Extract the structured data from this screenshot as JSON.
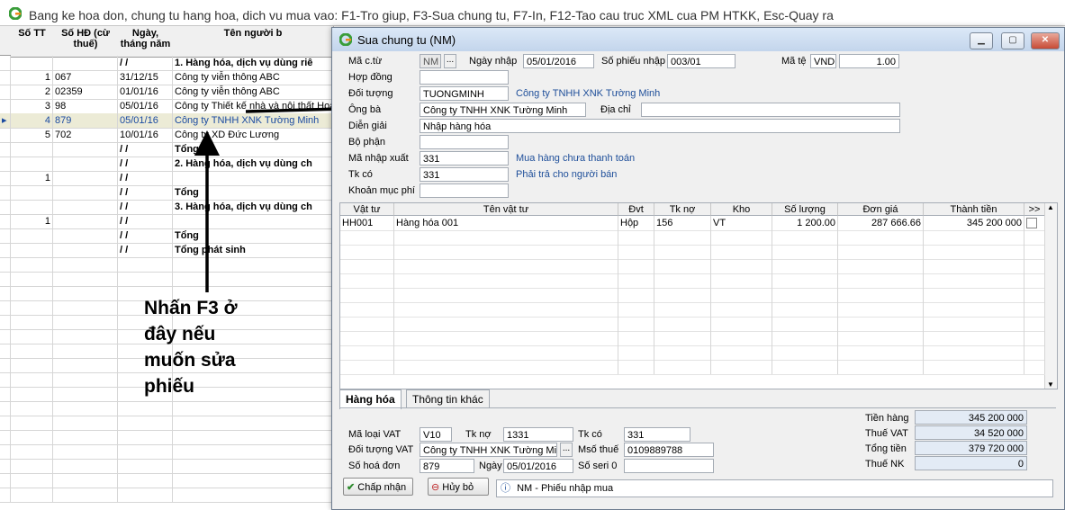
{
  "background": {
    "title": "Bang ke hoa don, chung tu hang hoa, dich vu mua vao: F1-Tro giup, F3-Sua chung tu, F7-In, F12-Tao cau truc XML cua PM HTKK, Esc-Quay ra",
    "columns": [
      "Số TT",
      "Số HĐ (cừ thuế)",
      "Ngày, tháng năm",
      "Tên người b"
    ],
    "rows": [
      {
        "stt": "",
        "so_hd": "",
        "ngay": "/ /",
        "ten": "1. Hàng hóa, dịch vụ dùng riê",
        "bold": true
      },
      {
        "stt": "1",
        "so_hd": "067",
        "ngay": "31/12/15",
        "ten": "Công ty viễn thông ABC"
      },
      {
        "stt": "2",
        "so_hd": "02359",
        "ngay": "01/01/16",
        "ten": "Công ty viễn thông ABC"
      },
      {
        "stt": "3",
        "so_hd": "98",
        "ngay": "05/01/16",
        "ten": "Công ty Thiết kế nhà và nội thất Hoà"
      },
      {
        "stt": "4",
        "so_hd": "879",
        "ngay": "05/01/16",
        "ten": "Công ty TNHH XNK Tường Minh",
        "selected": true
      },
      {
        "stt": "5",
        "so_hd": "702",
        "ngay": "10/01/16",
        "ten": "Công ty XD Đức Lương"
      },
      {
        "stt": "",
        "so_hd": "",
        "ngay": "/ /",
        "ten": "Tổng",
        "bold": true
      },
      {
        "stt": "",
        "so_hd": "",
        "ngay": "/ /",
        "ten": "2. Hàng hóa, dịch vụ dùng ch",
        "bold": true
      },
      {
        "stt": "1",
        "so_hd": "",
        "ngay": "/ /",
        "ten": ""
      },
      {
        "stt": "",
        "so_hd": "",
        "ngay": "/ /",
        "ten": "Tổng",
        "bold": true
      },
      {
        "stt": "",
        "so_hd": "",
        "ngay": "/ /",
        "ten": "3. Hàng hóa, dịch vụ dùng ch",
        "bold": true
      },
      {
        "stt": "1",
        "so_hd": "",
        "ngay": "/ /",
        "ten": ""
      },
      {
        "stt": "",
        "so_hd": "",
        "ngay": "/ /",
        "ten": "Tổng",
        "bold": true
      },
      {
        "stt": "",
        "so_hd": "",
        "ngay": "/ /",
        "ten": "Tổng phát sinh",
        "bold": true
      }
    ]
  },
  "callout": "Nhấn F3 ở\nđây nếu\nmuốn sửa\nphiếu",
  "dialog": {
    "title": "Sua chung tu (NM)",
    "labels": {
      "ma_ct": "Mã c.từ",
      "ngay_nhap": "Ngày nhập",
      "so_phieu": "Số phiếu nhập",
      "ma_te": "Mã tệ",
      "hop_dong": "Hợp đồng",
      "doi_tuong": "Đối tượng",
      "ong_ba": "Ông bà",
      "dia_chi": "Địa chỉ",
      "dien_giai": "Diễn giải",
      "bo_phan": "Bộ phận",
      "ma_nx": "Mã nhập xuất",
      "tk_co": "Tk có",
      "khoan_muc": "Khoản mục phí"
    },
    "values": {
      "ma_ct": "NM",
      "ngay_nhap": "05/01/2016",
      "so_phieu": "003/01",
      "ma_te": "VND",
      "ty_gia": "1.00",
      "hop_dong": "",
      "doi_tuong": "TUONGMINH",
      "doi_tuong_desc": "Công ty TNHH XNK Tường Minh",
      "ong_ba": "Công ty TNHH XNK Tường Minh",
      "dia_chi": "",
      "dien_giai": "Nhập hàng hóa",
      "bo_phan": "",
      "ma_nx": "331",
      "ma_nx_desc": "Mua hàng chưa thanh toán",
      "tk_co": "331",
      "tk_co_desc": "Phải trả cho người bán",
      "khoan_muc": ""
    },
    "grid": {
      "columns": [
        "Vật tư",
        "Tên vật tư",
        "Đvt",
        "Tk nợ",
        "Kho",
        "Số lượng",
        "Đơn giá",
        "Thành tiền",
        ">>"
      ],
      "rows": [
        {
          "vat_tu": "HH001",
          "ten": "Hàng hóa 001",
          "dvt": "Hộp",
          "tk_no": "156",
          "kho": "VT",
          "so_luong": "1 200.00",
          "don_gia": "287 666.66",
          "thanh_tien": "345 200 000"
        }
      ]
    },
    "tabs": [
      "Hàng hóa",
      "Thông tin khác"
    ],
    "vat": {
      "labels": {
        "ma_loai": "Mã loại VAT",
        "tk_no": "Tk nợ",
        "tk_co": "Tk có",
        "doi_tuong": "Đối tượng VAT",
        "mst": "Msố thuế",
        "so_hd": "Số hoá đơn",
        "ngay": "Ngày",
        "so_seri": "Số seri 0"
      },
      "values": {
        "ma_loai": "V10",
        "tk_no": "1331",
        "tk_co": "331",
        "doi_tuong": "Công ty TNHH XNK Tường Minh",
        "mst": "0109889788",
        "so_hd": "879",
        "ngay": "05/01/2016",
        "so_seri": ""
      }
    },
    "totals": {
      "labels": {
        "tien_hang": "Tiền hàng",
        "thue_vat": "Thuế VAT",
        "tong_tien": "Tổng tiền",
        "thue_nk": "Thuế NK"
      },
      "values": {
        "tien_hang": "345 200 000",
        "thue_vat": "34 520 000",
        "tong_tien": "379 720 000",
        "thue_nk": "0"
      }
    },
    "buttons": {
      "accept": "Chấp nhận",
      "cancel": "Hủy bỏ"
    },
    "status": "NM - Phiếu nhập mua"
  },
  "colors": {
    "accent": "#1f4f9a",
    "logo_green": "#3a9d3a",
    "logo_orange": "#f08a1c"
  }
}
